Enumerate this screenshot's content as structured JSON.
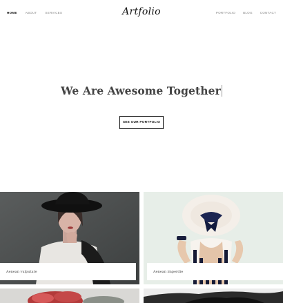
{
  "header": {
    "logo": "Artfolio",
    "nav_left": [
      {
        "label": "HOME",
        "active": true
      },
      {
        "label": "ABOUT",
        "active": false
      },
      {
        "label": "SERVICES",
        "active": false
      }
    ],
    "nav_right": [
      {
        "label": "PORTFOLIO"
      },
      {
        "label": "BLOG"
      },
      {
        "label": "CONTACT"
      }
    ]
  },
  "hero": {
    "title": "We Are Awesome Together",
    "cta_label": "SEE OUR PORTFOLIO"
  },
  "portfolio": {
    "items": [
      {
        "caption": "Aenean vulputate",
        "image": "woman-in-black-hat-photo"
      },
      {
        "caption": "Aenean imperdie",
        "image": "woman-with-striped-dress-and-hat-photo"
      },
      {
        "caption": "",
        "image": "red-foliage-photo"
      },
      {
        "caption": "",
        "image": "rocky-landscape-photo"
      }
    ]
  },
  "colors": {
    "text_dark": "#111111",
    "nav_muted": "#888888",
    "card1_bg": "#4f5252",
    "card2_bg": "#e7eee8"
  }
}
